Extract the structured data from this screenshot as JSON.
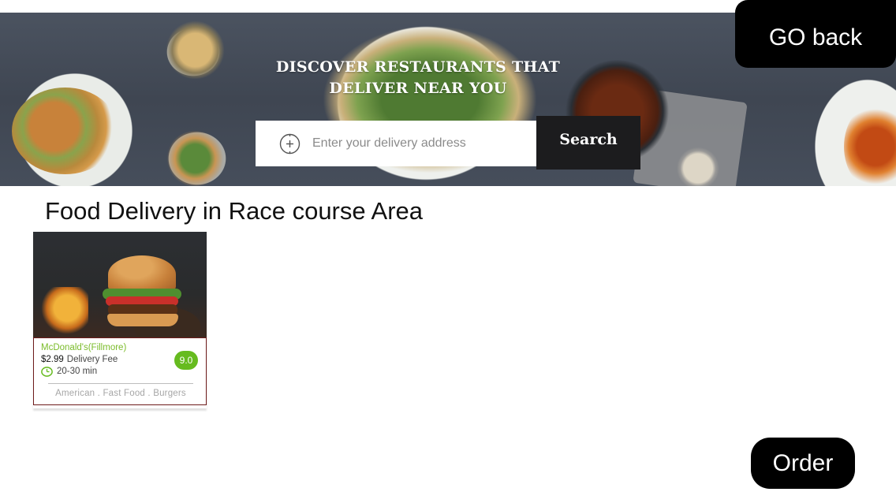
{
  "hero": {
    "title_line1": "DISCOVER RESTAURANTS THAT",
    "title_line2": "DELIVER NEAR YOU",
    "search": {
      "placeholder": "Enter your delivery address",
      "icon": "locate-icon",
      "button_label": "Search"
    }
  },
  "nav": {
    "go_back_label": "GO back"
  },
  "section": {
    "title": "Food Delivery in Race course Area"
  },
  "restaurants": [
    {
      "name": "McDonald's(Fillmore)",
      "fee_amount": "$2.99",
      "fee_label": "Delivery Fee",
      "delivery_time": "20-30 min",
      "rating": "9.0",
      "cuisines": "American . Fast Food . Burgers"
    }
  ],
  "actions": {
    "order_label": "Order"
  },
  "colors": {
    "accent_green": "#66bb1f",
    "name_green": "#7bbc2b",
    "button_black": "#000000",
    "card_border": "#6e1b1b"
  }
}
